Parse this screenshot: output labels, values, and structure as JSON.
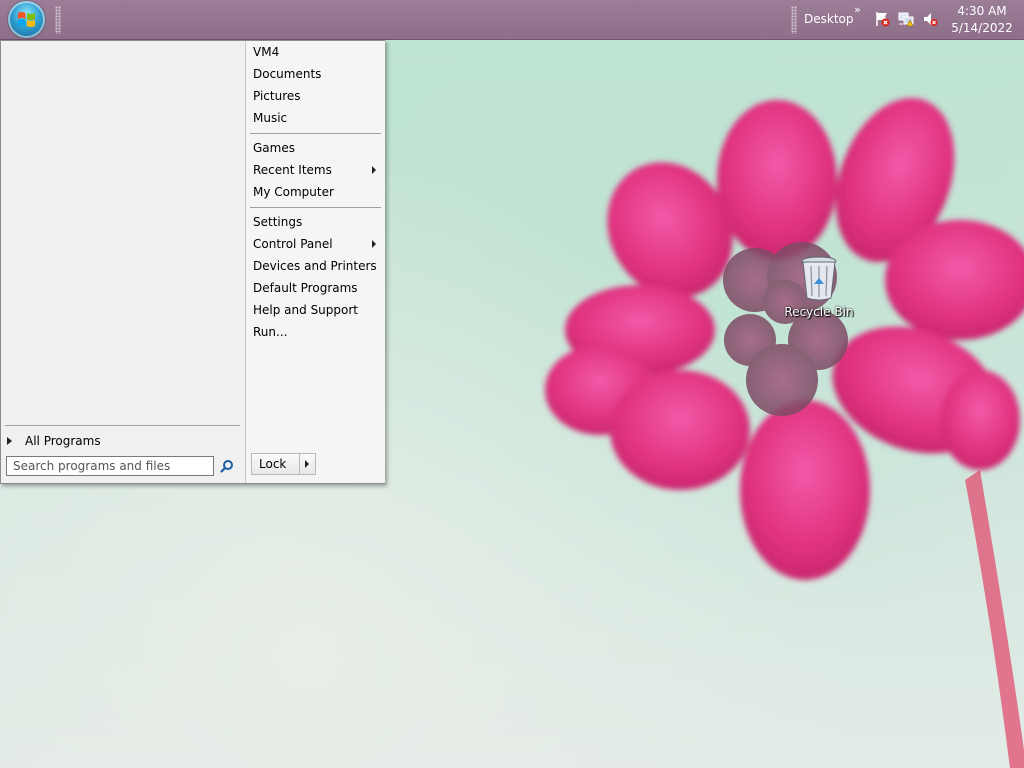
{
  "taskbar": {
    "desktop_label": "Desktop",
    "overflow_chevrons": "»",
    "clock": {
      "time": "4:30 AM",
      "date": "5/14/2022"
    },
    "tray_icons": [
      "action-center-flag-icon",
      "network-icon",
      "volume-muted-icon"
    ]
  },
  "start_menu": {
    "left": {
      "all_programs": "All Programs",
      "search_placeholder": "Search programs and files"
    },
    "right": {
      "items": [
        {
          "label": "VM4"
        },
        {
          "label": "Documents"
        },
        {
          "label": "Pictures"
        },
        {
          "label": "Music"
        },
        {
          "label": "Games"
        },
        {
          "label": "Recent Items",
          "submenu": true
        },
        {
          "label": "My Computer"
        },
        {
          "label": "Settings"
        },
        {
          "label": "Control Panel",
          "submenu": true
        },
        {
          "label": "Devices and Printers"
        },
        {
          "label": "Default Programs"
        },
        {
          "label": "Help and Support"
        },
        {
          "label": "Run..."
        }
      ],
      "lock_label": "Lock"
    }
  },
  "desktop": {
    "icons": [
      {
        "label": "Recycle Bin"
      }
    ]
  }
}
